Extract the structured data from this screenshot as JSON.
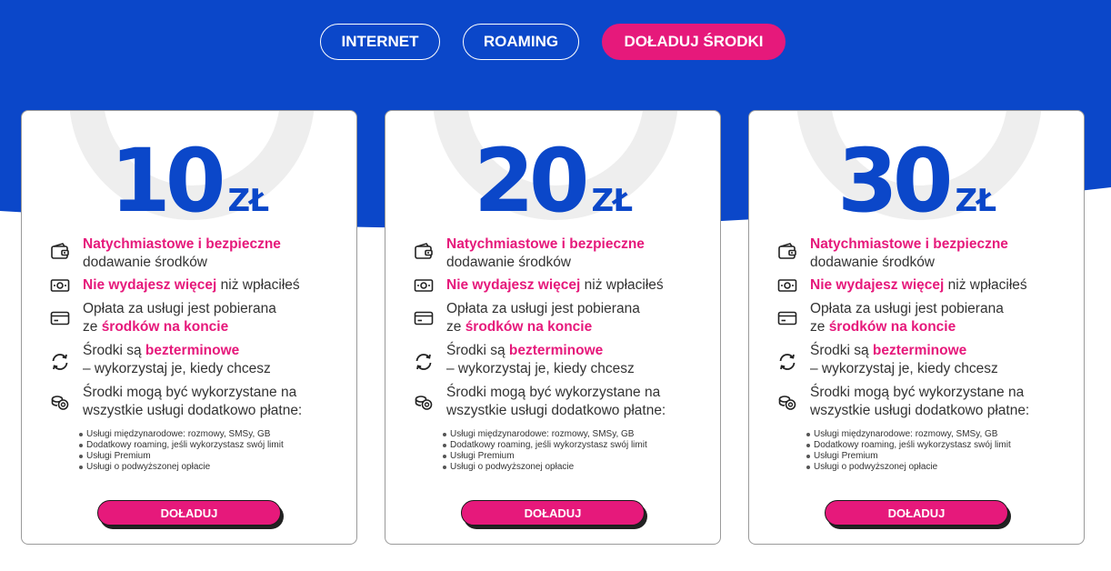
{
  "colors": {
    "brand_blue": "#0b47c9",
    "accent_pink": "#e6197b",
    "ring_gray": "#eeeeee"
  },
  "tabs": [
    {
      "label": "INTERNET",
      "active": false
    },
    {
      "label": "ROAMING",
      "active": false
    },
    {
      "label": "DOŁADUJ ŚRODKI",
      "active": true
    }
  ],
  "cards": [
    {
      "amount": "10",
      "currency": "ZŁ",
      "features": [
        {
          "icon": "wallet-icon",
          "hl": "Natychmiastowe i bezpieczne",
          "line2": "dodawanie środków"
        },
        {
          "icon": "cash-icon",
          "hl": "Nie wydajesz więcej",
          "rest": " niż wpłaciłeś"
        },
        {
          "icon": "card-icon",
          "line1": "Opłata za usługi jest pobierana",
          "pre": "ze ",
          "hl": "środków na koncie"
        },
        {
          "icon": "refresh-icon",
          "pre": "Środki są ",
          "hl": "bezterminowe",
          "line2": "– wykorzystaj je, kiedy chcesz"
        },
        {
          "icon": "coins-icon",
          "line1": "Środki mogą być wykorzystane na",
          "line2": "wszystkie usługi dodatkowo płatne:"
        }
      ],
      "bullets": [
        "Usługi międzynarodowe: rozmowy, SMSy, GB",
        "Dodatkowy roaming, jeśli wykorzystasz swój limit",
        "Usługi Premium",
        "Usługi o podwyższonej opłacie"
      ],
      "button": "DOŁADUJ"
    },
    {
      "amount": "20",
      "currency": "ZŁ",
      "features": [
        {
          "icon": "wallet-icon",
          "hl": "Natychmiastowe i bezpieczne",
          "line2": "dodawanie środków"
        },
        {
          "icon": "cash-icon",
          "hl": "Nie wydajesz więcej",
          "rest": " niż wpłaciłeś"
        },
        {
          "icon": "card-icon",
          "line1": "Opłata za usługi jest pobierana",
          "pre": "ze ",
          "hl": "środków na koncie"
        },
        {
          "icon": "refresh-icon",
          "pre": "Środki są ",
          "hl": "bezterminowe",
          "line2": "– wykorzystaj je, kiedy chcesz"
        },
        {
          "icon": "coins-icon",
          "line1": "Środki mogą być wykorzystane na",
          "line2": "wszystkie usługi dodatkowo płatne:"
        }
      ],
      "bullets": [
        "Usługi międzynarodowe: rozmowy, SMSy, GB",
        "Dodatkowy roaming, jeśli wykorzystasz swój limit",
        "Usługi Premium",
        "Usługi o podwyższonej opłacie"
      ],
      "button": "DOŁADUJ"
    },
    {
      "amount": "30",
      "currency": "ZŁ",
      "features": [
        {
          "icon": "wallet-icon",
          "hl": "Natychmiastowe i bezpieczne",
          "line2": "dodawanie środków"
        },
        {
          "icon": "cash-icon",
          "hl": "Nie wydajesz więcej",
          "rest": " niż wpłaciłeś"
        },
        {
          "icon": "card-icon",
          "line1": "Opłata za usługi jest pobierana",
          "pre": "ze ",
          "hl": "środków na koncie"
        },
        {
          "icon": "refresh-icon",
          "pre": "Środki są ",
          "hl": "bezterminowe",
          "line2": "– wykorzystaj je, kiedy chcesz"
        },
        {
          "icon": "coins-icon",
          "line1": "Środki mogą być wykorzystane na",
          "line2": "wszystkie usługi dodatkowo płatne:"
        }
      ],
      "bullets": [
        "Usługi międzynarodowe: rozmowy, SMSy, GB",
        "Dodatkowy roaming, jeśli wykorzystasz swój limit",
        "Usługi Premium",
        "Usługi o podwyższonej opłacie"
      ],
      "button": "DOŁADUJ"
    }
  ]
}
